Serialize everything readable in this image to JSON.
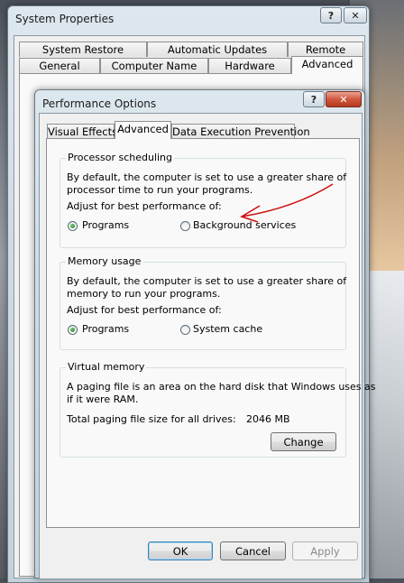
{
  "back_window": {
    "title": "System Properties",
    "help_btn": "?",
    "close_btn": "✕",
    "tabs_row1": [
      "System Restore",
      "Automatic Updates",
      "Remote"
    ],
    "tabs_row2": [
      "General",
      "Computer Name",
      "Hardware",
      "Advanced"
    ]
  },
  "dialog": {
    "title": "Performance Options",
    "help_btn": "?",
    "close_btn": "✕",
    "tabs": [
      "Visual Effects",
      "Advanced",
      "Data Execution Prevention"
    ],
    "processor": {
      "title": "Processor scheduling",
      "desc1": "By default, the computer is set to use a greater share of",
      "desc2": "processor time to run your programs.",
      "adjust": "Adjust for best performance of:",
      "opt_programs": "Programs",
      "opt_background": "Background services",
      "selected": "Programs"
    },
    "memory": {
      "title": "Memory usage",
      "desc1": "By default, the computer is set to use a greater share of",
      "desc2": "memory to run your programs.",
      "adjust": "Adjust for best performance of:",
      "opt_programs": "Programs",
      "opt_cache": "System cache",
      "selected": "Programs"
    },
    "virtual": {
      "title": "Virtual memory",
      "desc1": "A paging file is an area on the hard disk that Windows uses as",
      "desc2": "if it were RAM.",
      "total_label": "Total paging file size for all drives:",
      "total_value": "2046 MB",
      "change": "Change"
    },
    "buttons": {
      "ok": "OK",
      "cancel": "Cancel",
      "apply": "Apply"
    }
  },
  "colors": {
    "annotation_arrow": "#d01010",
    "radio_dot": "#1a7f1a"
  },
  "icons": [
    "help-icon",
    "close-icon",
    "arrow-annotation"
  ]
}
